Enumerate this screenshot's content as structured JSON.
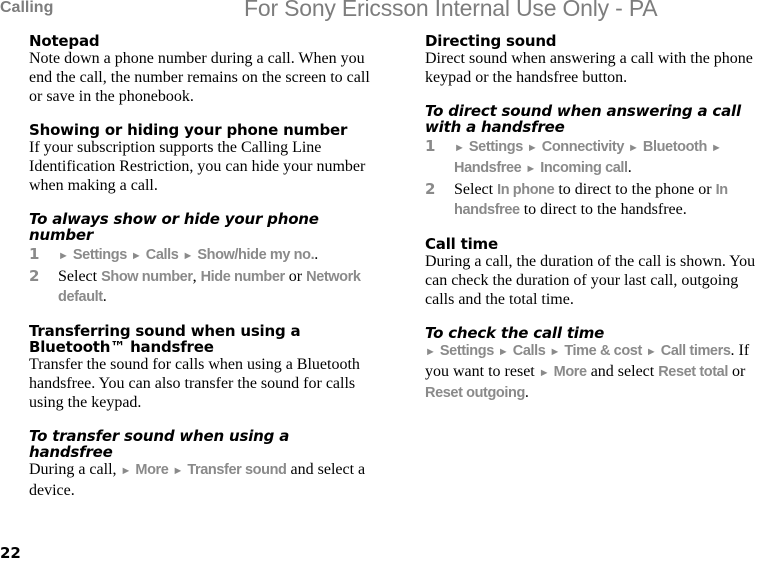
{
  "header": {
    "section_title": "Calling",
    "watermark": "For Sony Ericsson Internal Use Only - PA"
  },
  "left_column": {
    "notepad": {
      "heading": "Notepad",
      "text": "Note down a phone number during a call. When you end the call, the number remains on the screen to call or save in the phonebook."
    },
    "show_hide": {
      "heading": "Showing or hiding your phone number",
      "text": "If your subscription supports the Calling Line Identification Restriction, you can hide your number when making a call."
    },
    "always_show_hide": {
      "heading": "To always show or hide your phone number",
      "steps": [
        {
          "num": "1",
          "menu_path": [
            "Settings",
            "Calls",
            "Show/hide my no."
          ],
          "suffix": "."
        },
        {
          "num": "2",
          "prefix": "Select ",
          "option1": "Show number",
          "sep1": ", ",
          "option2": "Hide number",
          "sep2": " or ",
          "option3": "Network default",
          "suffix": "."
        }
      ]
    },
    "transferring": {
      "heading": "Transferring sound when using a Bluetooth™ handsfree",
      "text": "Transfer the sound for calls when using a Bluetooth handsfree. You can also transfer the sound for calls using the keypad."
    },
    "to_transfer": {
      "heading": "To transfer sound when using a handsfree",
      "prefix": "During a call, ",
      "menu_path": [
        "More",
        "Transfer sound"
      ],
      "suffix": " and select a device."
    }
  },
  "right_column": {
    "directing": {
      "heading": "Directing sound",
      "text": "Direct sound when answering a call with the phone keypad or the handsfree button."
    },
    "to_direct": {
      "heading": "To direct sound when answering a call with a handsfree",
      "steps": [
        {
          "num": "1",
          "menu_path": [
            "Settings",
            "Connectivity",
            "Bluetooth",
            "Handsfree",
            "Incoming call"
          ],
          "suffix": "."
        },
        {
          "num": "2",
          "prefix": "Select ",
          "option1": "In phone",
          "mid": " to direct to the phone or ",
          "option2": "In handsfree",
          "suffix": " to direct to the handsfree."
        }
      ]
    },
    "call_time": {
      "heading": "Call time",
      "text": "During a call, the duration of the call is shown. You can check the duration of your last call, outgoing calls and the total time."
    },
    "check_call_time": {
      "heading": "To check the call time",
      "menu_path": [
        "Settings",
        "Calls",
        "Time & cost",
        "Call timers"
      ],
      "mid1": ". If you want to reset ",
      "more": "More",
      "mid2": " and select ",
      "option1": "Reset total",
      "mid3": " or ",
      "option2": "Reset outgoing",
      "suffix": "."
    }
  },
  "icons": {
    "menu_arrow": "►"
  },
  "footer": {
    "page_number": "22"
  },
  "colors": {
    "menu_text": "#8a8a8a",
    "header_text": "#7d7d7d",
    "body_text": "#000000"
  }
}
